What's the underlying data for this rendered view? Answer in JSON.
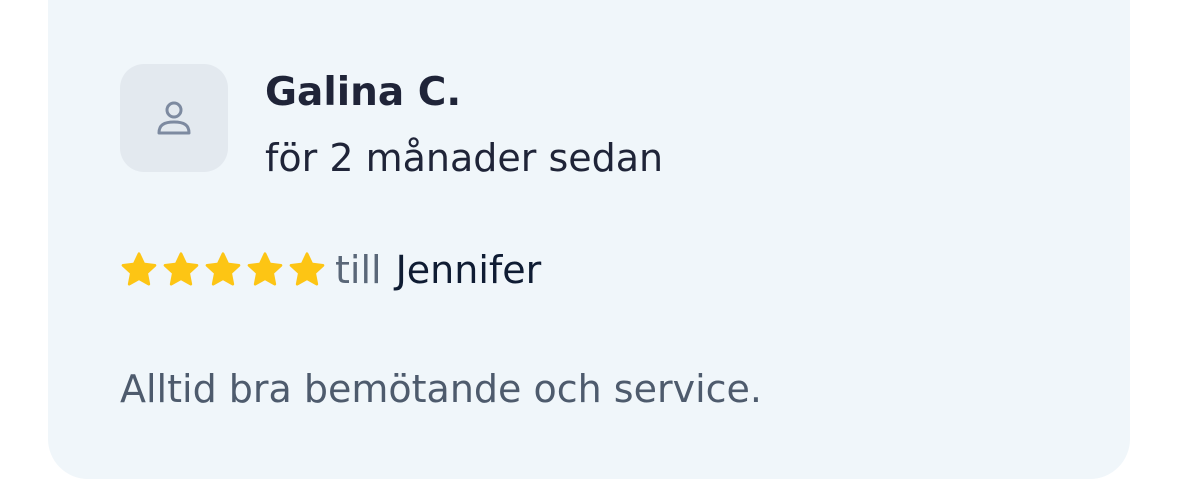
{
  "review": {
    "avatar_icon": "user-icon",
    "reviewer_name": "Galina C.",
    "time_ago": "för 2 månader sedan",
    "rating": 5,
    "max_rating": 5,
    "star_icon": "star-icon",
    "star_color": "#fdc514",
    "till_label": "till",
    "staff_name": "Jennifer",
    "text": "Alltid bra bemötande och service."
  },
  "colors": {
    "card_background": "#f0f6fa",
    "avatar_background": "#e3e9ef",
    "avatar_icon": "#7d8aa0",
    "name_text": "#1f2438",
    "body_text": "#4e5b6d"
  }
}
